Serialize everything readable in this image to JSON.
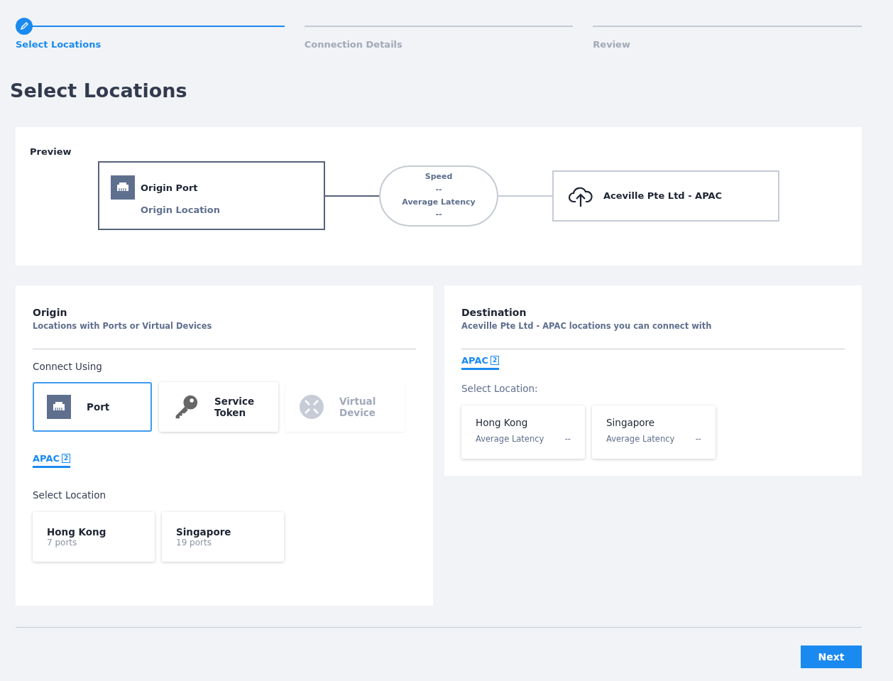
{
  "steps": [
    {
      "label": "Select Locations",
      "selected": true
    },
    {
      "label": "Connection Details",
      "selected": false
    },
    {
      "label": "Review",
      "selected": false
    }
  ],
  "page_title": "Select Locations",
  "preview": {
    "title": "Preview",
    "origin": {
      "name": "Origin Port",
      "location": "Origin Location"
    },
    "metrics": {
      "speed_label": "Speed",
      "speed_value": "--",
      "latency_label": "Average Latency",
      "latency_value": "--"
    },
    "destination": {
      "name": "Aceville Pte Ltd - APAC"
    }
  },
  "origin": {
    "title": "Origin",
    "subtitle": "Locations with Ports or Virtual Devices",
    "connect_label": "Connect Using",
    "options": [
      {
        "kind": "port",
        "label": "Port",
        "selected": true,
        "disabled": false
      },
      {
        "kind": "token",
        "label": "Service Token",
        "selected": false,
        "disabled": false
      },
      {
        "kind": "virtual",
        "label": "Virtual Device",
        "selected": false,
        "disabled": true
      }
    ],
    "tabs": [
      {
        "label": "APAC",
        "count": "2",
        "selected": true
      }
    ],
    "select_label": "Select Location",
    "locations": [
      {
        "name": "Hong Kong",
        "ports": "7 ports"
      },
      {
        "name": "Singapore",
        "ports": "19 ports"
      }
    ]
  },
  "destination": {
    "title": "Destination",
    "subtitle": "Aceville Pte Ltd - APAC locations you can connect with",
    "tabs": [
      {
        "label": "APAC",
        "count": "2",
        "selected": true
      }
    ],
    "select_label": "Select Location:",
    "locations": [
      {
        "name": "Hong Kong",
        "metric_label": "Average Latency",
        "metric_value": "--"
      },
      {
        "name": "Singapore",
        "metric_label": "Average Latency",
        "metric_value": "--"
      }
    ]
  },
  "next_button": "Next"
}
